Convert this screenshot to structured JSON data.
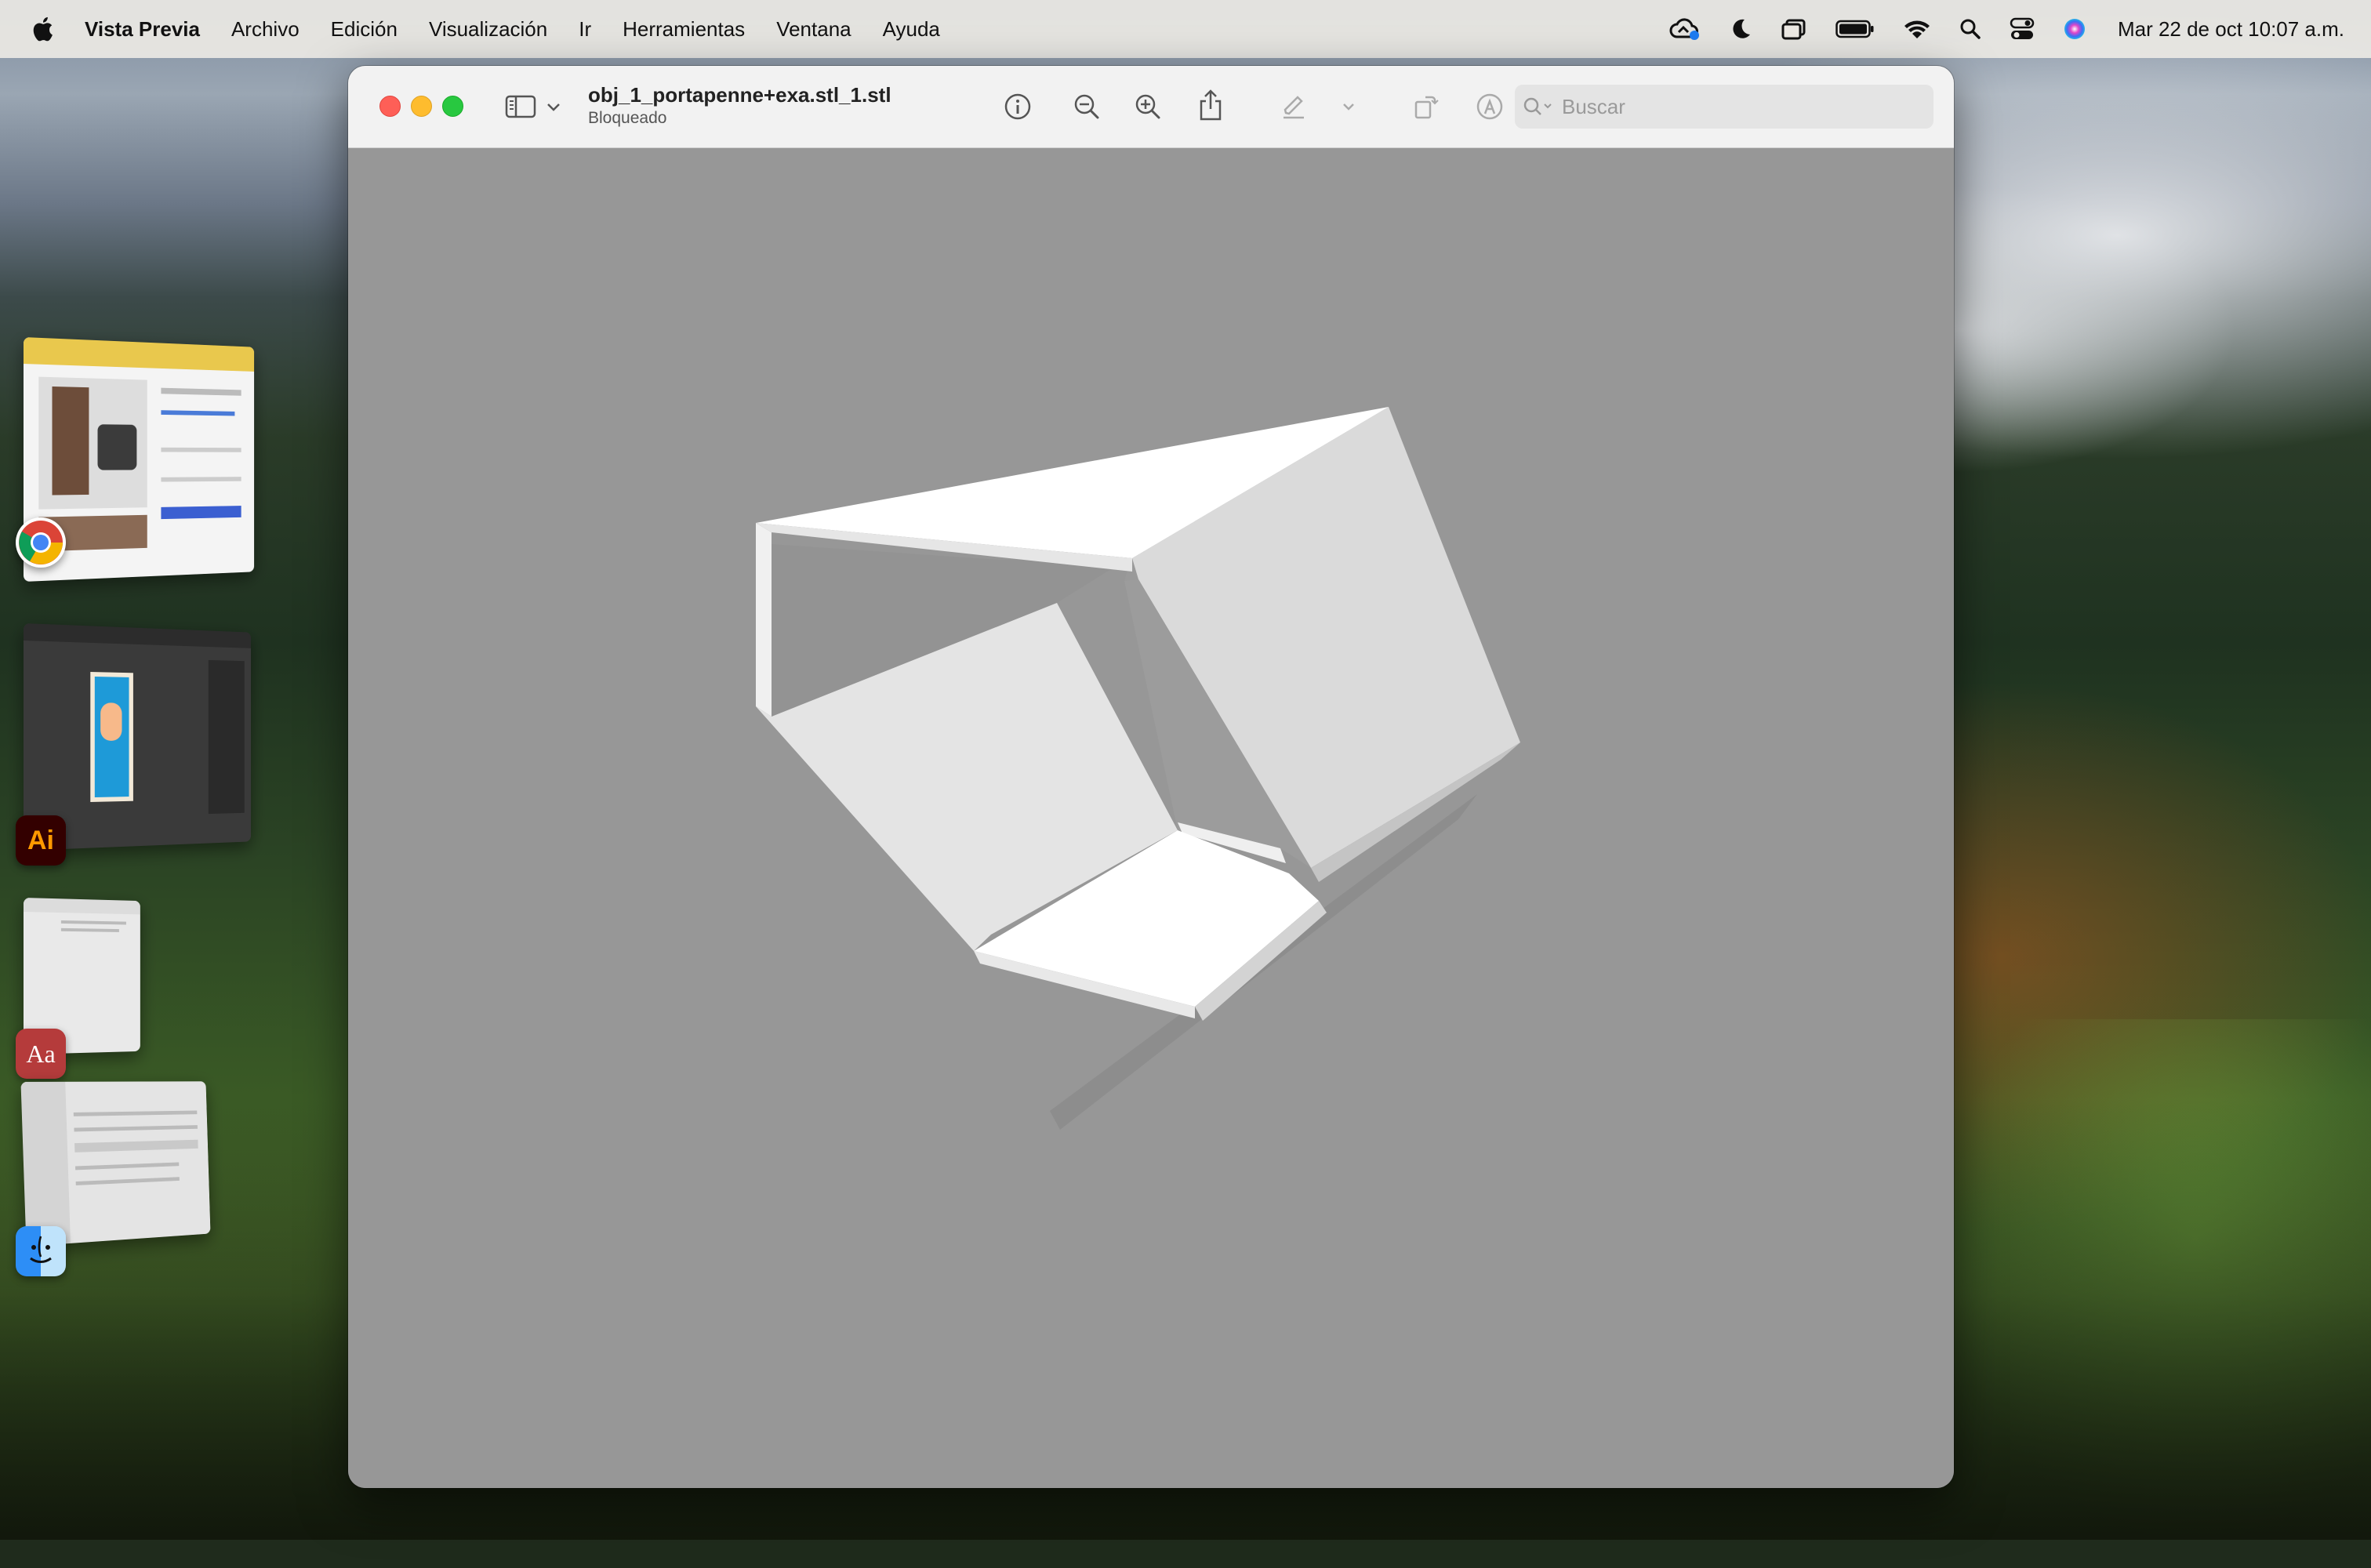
{
  "menubar": {
    "app_name": "Vista Previa",
    "items": [
      "Archivo",
      "Edición",
      "Visualización",
      "Ir",
      "Herramientas",
      "Ventana",
      "Ayuda"
    ],
    "clock": "Mar 22 de oct  10:07 a.m."
  },
  "stage_manager": {
    "apps": [
      {
        "name": "Google Chrome",
        "icon": "chrome-icon"
      },
      {
        "name": "Adobe Illustrator",
        "icon": "illustrator-icon",
        "badge": "Ai"
      },
      {
        "name": "Diccionario",
        "icon": "dictionary-icon",
        "badge": "Aa"
      },
      {
        "name": "Finder",
        "icon": "finder-icon"
      }
    ]
  },
  "window": {
    "title": "obj_1_portapenne+exa.stl_1.stl",
    "subtitle": "Bloqueado",
    "search_placeholder": "Buscar"
  },
  "colors": {
    "canvas_bg": "#979797",
    "model_light": "#ffffff",
    "model_mid": "#dcdcdc",
    "model_shadow": "#8f8f8f"
  }
}
